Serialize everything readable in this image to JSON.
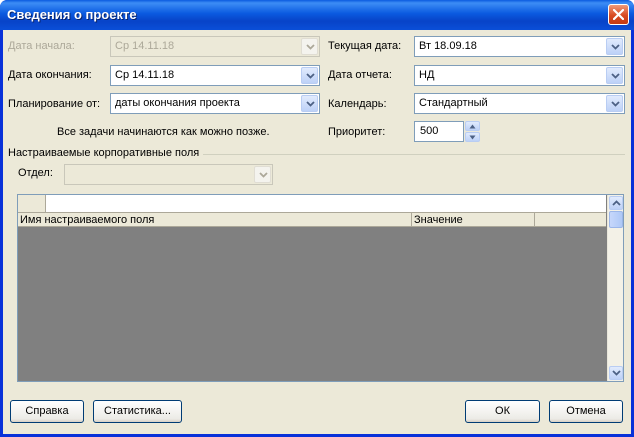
{
  "window": {
    "title": "Сведения о проекте",
    "close_icon": "close-icon"
  },
  "fields": {
    "start_date": {
      "label": "Дата начала:",
      "value": "Ср 14.11.18",
      "enabled": false
    },
    "finish_date": {
      "label": "Дата окончания:",
      "value": "Ср 14.11.18",
      "enabled": true
    },
    "schedule_from": {
      "label": "Планирование от:",
      "value": "даты окончания проекта"
    },
    "current_date": {
      "label": "Текущая дата:",
      "value": "Вт 18.09.18"
    },
    "status_date": {
      "label": "Дата отчета:",
      "value": "НД"
    },
    "calendar": {
      "label": "Календарь:",
      "value": "Стандартный"
    },
    "priority": {
      "label": "Приоритет:",
      "value": "500"
    },
    "note": "Все задачи начинаются как можно позже."
  },
  "enterprise": {
    "group_label": "Настраиваемые корпоративные поля",
    "department_label": "Отдел:",
    "department_value": ""
  },
  "grid": {
    "columns": [
      "Имя настраиваемого поля",
      "Значение"
    ]
  },
  "buttons": {
    "help": "Справка",
    "statistics": "Статистика...",
    "ok": "ОК",
    "cancel": "Отмена"
  },
  "colors": {
    "titlebar": "#0a5ae0",
    "dialog_bg": "#ece9d8",
    "grid_body": "#808080"
  }
}
